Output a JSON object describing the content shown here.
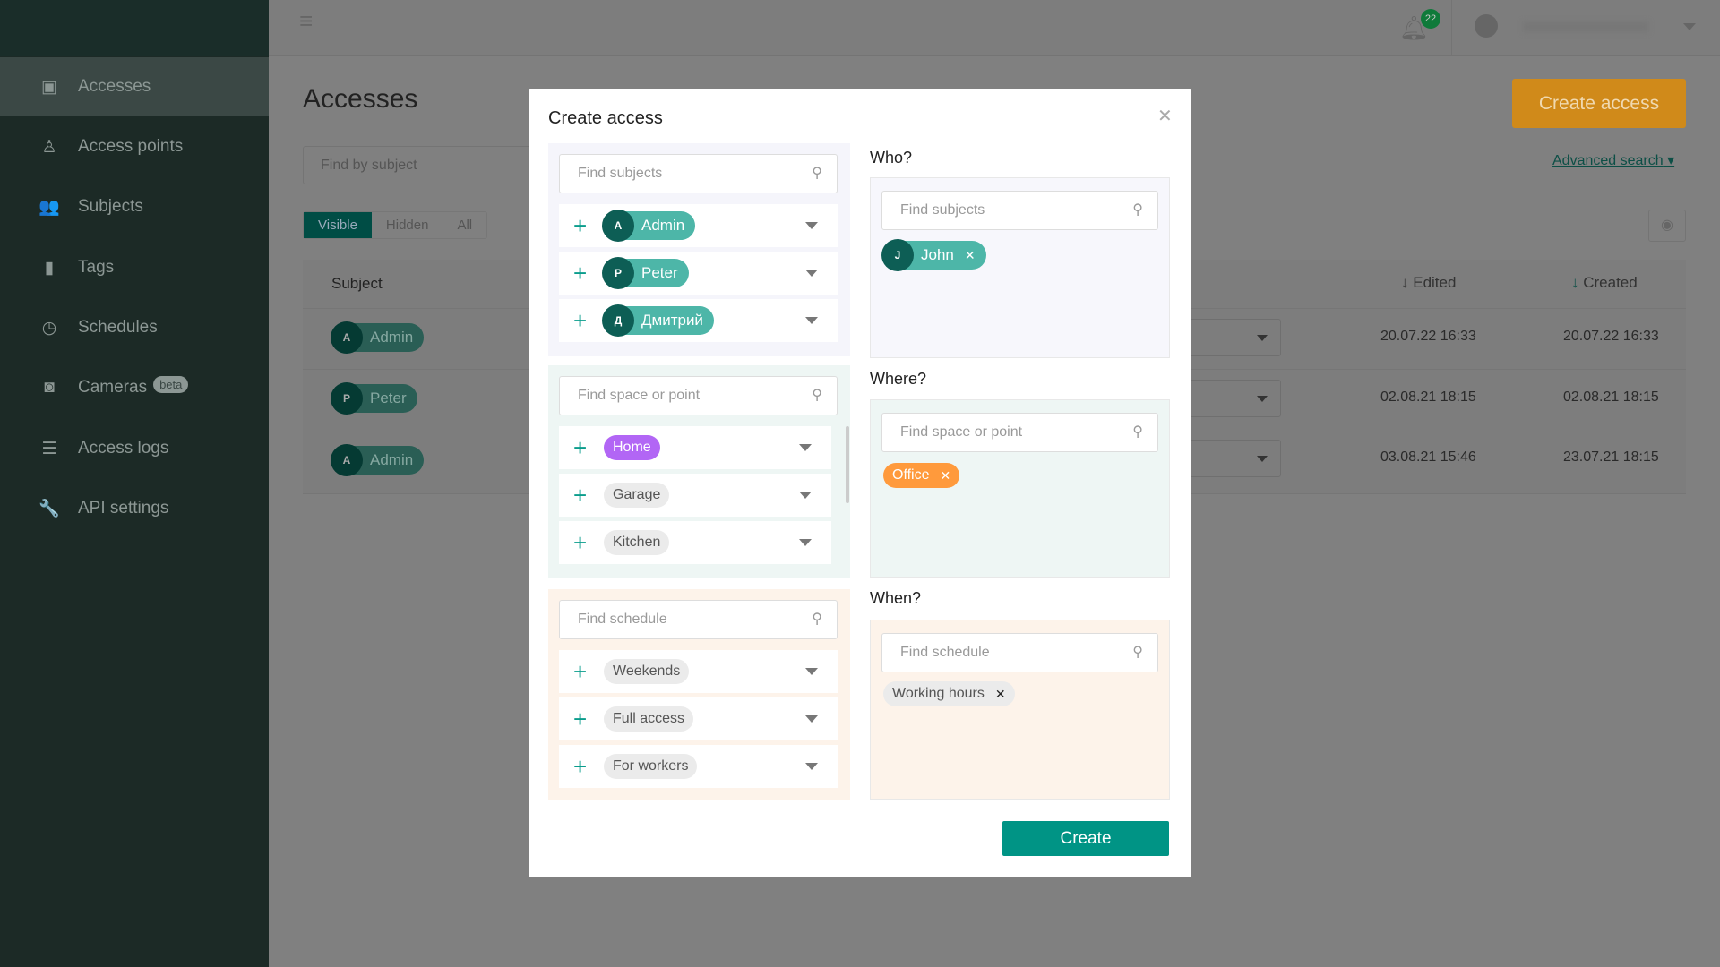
{
  "sidebar": {
    "items": [
      {
        "label": "Accesses",
        "icon": "clipboard-check-icon"
      },
      {
        "label": "Access points",
        "icon": "person-pin-icon"
      },
      {
        "label": "Subjects",
        "icon": "people-icon"
      },
      {
        "label": "Tags",
        "icon": "tag-icon"
      },
      {
        "label": "Schedules",
        "icon": "clock-icon"
      },
      {
        "label": "Cameras",
        "icon": "camera-icon",
        "badge": "beta"
      },
      {
        "label": "Access logs",
        "icon": "list-icon"
      },
      {
        "label": "API settings",
        "icon": "wrench-icon"
      }
    ]
  },
  "header": {
    "notifications": "22"
  },
  "page": {
    "title": "Accesses",
    "search_placeholder": "Find by subject",
    "create_label": "Create access",
    "advanced_search": "Advanced search",
    "tabs": [
      "Visible",
      "Hidden",
      "All"
    ],
    "columns": {
      "subject": "Subject",
      "edited": "Edited",
      "created": "Created"
    },
    "rows": [
      {
        "initial": "A",
        "subject": "Admin",
        "edited": "20.07.22 16:33",
        "created": "20.07.22 16:33"
      },
      {
        "initial": "P",
        "subject": "Peter",
        "edited": "02.08.21 18:15",
        "created": "02.08.21 18:15"
      },
      {
        "initial": "A",
        "subject": "Admin",
        "edited": "03.08.21 15:46",
        "created": "23.07.21 18:15"
      }
    ]
  },
  "modal": {
    "title": "Create access",
    "create": "Create",
    "subjects": {
      "placeholder": "Find subjects",
      "items": [
        {
          "initial": "A",
          "label": "Admin"
        },
        {
          "initial": "P",
          "label": "Peter"
        },
        {
          "initial": "Д",
          "label": "Дмитрий"
        }
      ]
    },
    "spaces": {
      "placeholder": "Find space or point",
      "items": [
        {
          "label": "Home",
          "color": "#b266f5"
        },
        {
          "label": "Garage"
        },
        {
          "label": "Kitchen"
        }
      ]
    },
    "schedules": {
      "placeholder": "Find schedule",
      "items": [
        {
          "label": "Weekends"
        },
        {
          "label": "Full access"
        },
        {
          "label": "For workers"
        }
      ]
    },
    "who": {
      "label": "Who?",
      "placeholder": "Find subjects",
      "selected": {
        "initial": "J",
        "label": "John"
      }
    },
    "where": {
      "label": "Where?",
      "placeholder": "Find space or point",
      "selected": {
        "label": "Office",
        "color": "#ff9a3c"
      }
    },
    "when": {
      "label": "When?",
      "placeholder": "Find schedule",
      "selected": {
        "label": "Working hours"
      }
    }
  },
  "colors": {
    "accent": "#009485",
    "create_access": "#d08a1a"
  }
}
